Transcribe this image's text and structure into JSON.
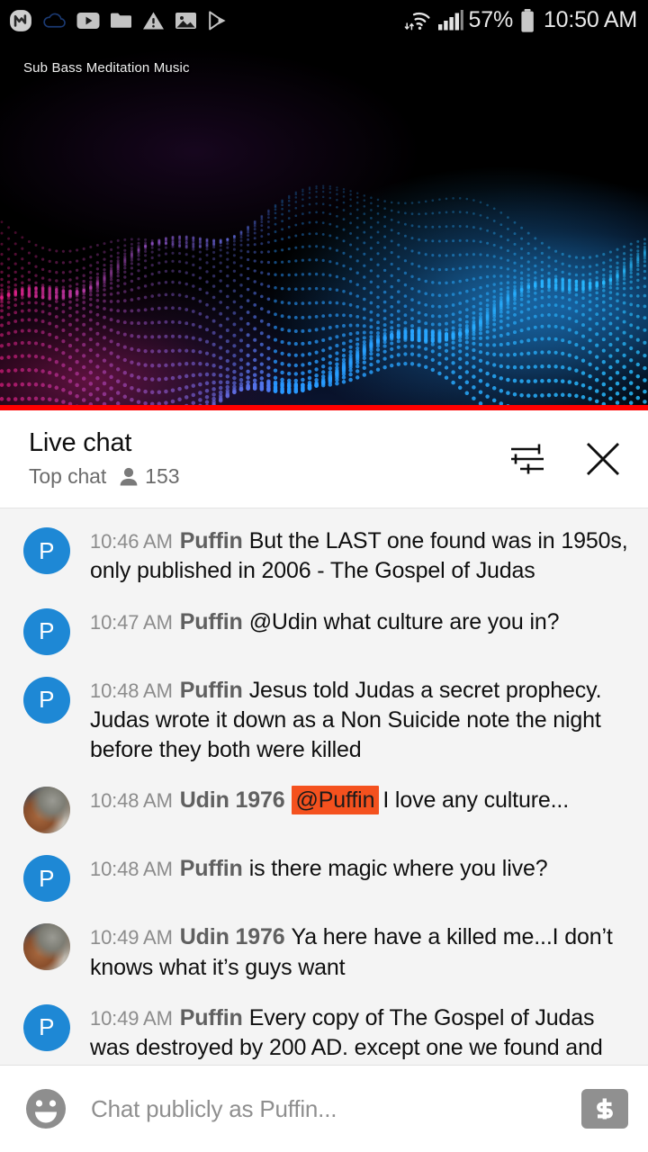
{
  "status_bar": {
    "icons": [
      "messenger-icon",
      "cloud-icon",
      "youtube-icon",
      "folder-icon",
      "warning-icon",
      "photo-icon",
      "play-store-icon"
    ],
    "wifi_icon": "wifi-icon",
    "signal_icon": "cellular-signal-icon",
    "battery_percent": "57%",
    "battery_icon": "battery-icon",
    "clock": "10:50 AM"
  },
  "player": {
    "video_title": "Sub Bass Meditation Music",
    "progress_percent": 100,
    "progress_color": "#ff0000"
  },
  "chat_header": {
    "title": "Live chat",
    "mode": "Top chat",
    "viewer_icon": "person-icon",
    "viewer_count": "153",
    "settings_icon": "tune-icon",
    "close_icon": "close-icon"
  },
  "messages": [
    {
      "avatar_type": "letter",
      "avatar_letter": "P",
      "avatar_color": "#1e88d5",
      "time": "10:46 AM",
      "author": "Puffin",
      "mention": "",
      "text": "But the LAST one found was in 1950s, only published in 2006 - The Gospel of Judas"
    },
    {
      "avatar_type": "letter",
      "avatar_letter": "P",
      "avatar_color": "#1e88d5",
      "time": "10:47 AM",
      "author": "Puffin",
      "mention": "",
      "text": "@Udin what culture are you in?"
    },
    {
      "avatar_type": "letter",
      "avatar_letter": "P",
      "avatar_color": "#1e88d5",
      "time": "10:48 AM",
      "author": "Puffin",
      "mention": "",
      "text": "Jesus told Judas a secret prophecy. Judas wrote it down as a Non Suicide note the night before they both were killed"
    },
    {
      "avatar_type": "photo",
      "avatar_letter": "",
      "avatar_color": "",
      "time": "10:48 AM",
      "author": "Udin 1976",
      "mention": "@Puffin",
      "text": "I love any culture..."
    },
    {
      "avatar_type": "letter",
      "avatar_letter": "P",
      "avatar_color": "#1e88d5",
      "time": "10:48 AM",
      "author": "Puffin",
      "mention": "",
      "text": "is there magic where you live?"
    },
    {
      "avatar_type": "photo",
      "avatar_letter": "",
      "avatar_color": "",
      "time": "10:49 AM",
      "author": "Udin 1976",
      "mention": "",
      "text": "Ya here have a killed me...I don’t knows what it’s guys want"
    },
    {
      "avatar_type": "letter",
      "avatar_letter": "P",
      "avatar_color": "#1e88d5",
      "time": "10:49 AM",
      "author": "Puffin",
      "mention": "",
      "text": "Every copy of The Gospel of Judas was destroyed by 200 AD. except one we found and let it decompose. unless we just found more...."
    }
  ],
  "input_bar": {
    "emoji_icon": "emoji-smiley-icon",
    "placeholder": "Chat publicly as Puffin...",
    "value": "",
    "superchat_icon": "dollar-sign-icon"
  },
  "colors": {
    "mention_highlight": "#f4511e",
    "avatar_blue": "#1e88d5",
    "chat_background": "#f4f4f4",
    "progress_red": "#ff0000"
  }
}
